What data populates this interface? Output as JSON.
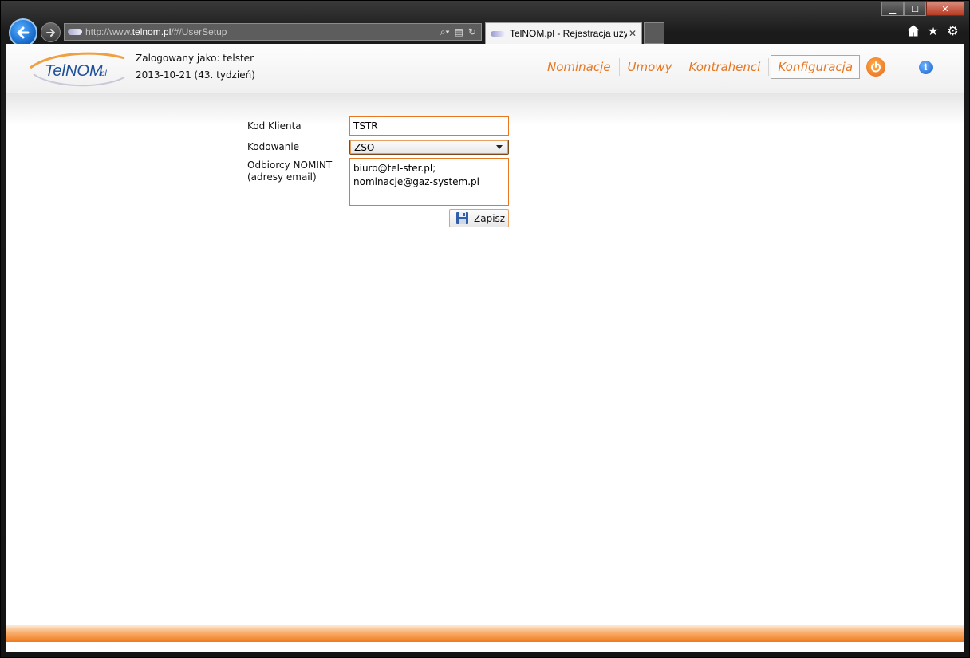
{
  "browser": {
    "url_prefix": "http://www.",
    "url_domain": "telnom.pl",
    "url_path": "/#/UserSetup",
    "tab_title": "TelNOM.pl - Rejestracja uży...",
    "tab_close": "✕",
    "window_controls": {
      "minimize": "▁",
      "maximize": "☐",
      "close": "✕"
    },
    "toolbar_icons": [
      "home-icon",
      "favorites-star-icon",
      "settings-gear-icon"
    ]
  },
  "header": {
    "logo_text": "TelNOM",
    "logo_suffix": "pl",
    "logged_in": "Zalogowany jako: telster",
    "date": "2013-10-21 (43. tydzień)",
    "nav": [
      {
        "label": "Nominacje",
        "active": false
      },
      {
        "label": "Umowy",
        "active": false
      },
      {
        "label": "Kontrahenci",
        "active": false
      },
      {
        "label": "Konfiguracja",
        "active": true
      }
    ],
    "info_label": "i"
  },
  "form": {
    "client_code_label": "Kod Klienta",
    "client_code_value": "TSTR",
    "encoding_label": "Kodowanie",
    "encoding_value": "ZSO",
    "recipients_label_line1": "Odbiorcy NOMINT",
    "recipients_label_line2": "(adresy email)",
    "recipients_value": "biuro@tel-ster.pl;\nnominacje@gaz-system.pl",
    "save_label": "Zapisz"
  },
  "colors": {
    "accent": "#e87722",
    "input_border": "#e87722"
  }
}
